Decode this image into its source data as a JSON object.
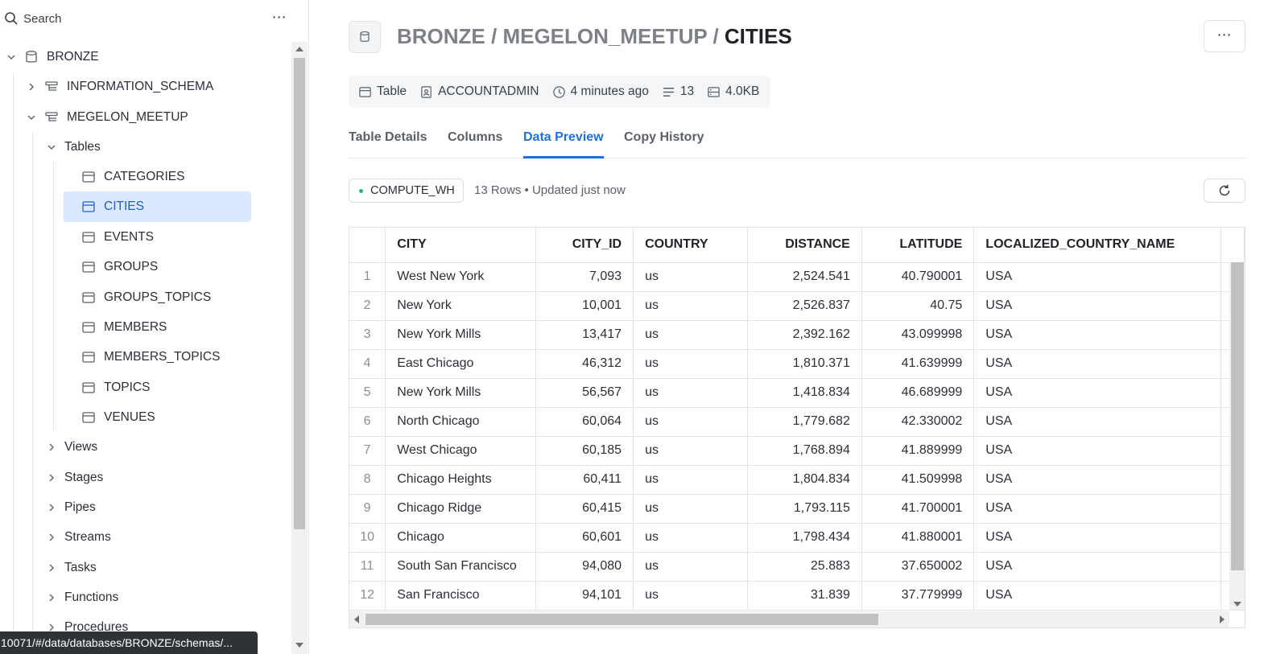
{
  "sidebar": {
    "search_label": "Search",
    "more_label": "⋯",
    "database": "BRONZE",
    "schemas": [
      "INFORMATION_SCHEMA",
      "MEGELON_MEETUP"
    ],
    "tables_label": "Tables",
    "tables": [
      "CATEGORIES",
      "CITIES",
      "EVENTS",
      "GROUPS",
      "GROUPS_TOPICS",
      "MEMBERS",
      "MEMBERS_TOPICS",
      "TOPICS",
      "VENUES"
    ],
    "selected_table": "CITIES",
    "groups": [
      "Views",
      "Stages",
      "Pipes",
      "Streams",
      "Tasks",
      "Functions",
      "Procedures"
    ]
  },
  "status_url": "10071/#/data/databases/BRONZE/schemas/...",
  "header": {
    "crumb_db": "BRONZE / ",
    "crumb_schema": "MEGELON_MEETUP / ",
    "crumb_table": "CITIES",
    "more_label": "⋯"
  },
  "meta": {
    "type": "Table",
    "owner": "ACCOUNTADMIN",
    "modified": "4 minutes ago",
    "row_count": "13",
    "size": "4.0KB"
  },
  "tabs": [
    "Table Details",
    "Columns",
    "Data Preview",
    "Copy History"
  ],
  "active_tab": "Data Preview",
  "preview": {
    "warehouse": "COMPUTE_WH",
    "rows_info": "13 Rows • Updated just now"
  },
  "table": {
    "columns": [
      "CITY",
      "CITY_ID",
      "COUNTRY",
      "DISTANCE",
      "LATITUDE",
      "LOCALIZED_COUNTRY_NAME"
    ],
    "rows": [
      [
        "1",
        "West New York",
        "7,093",
        "us",
        "2,524.541",
        "40.790001",
        "USA"
      ],
      [
        "2",
        "New York",
        "10,001",
        "us",
        "2,526.837",
        "40.75",
        "USA"
      ],
      [
        "3",
        "New York Mills",
        "13,417",
        "us",
        "2,392.162",
        "43.099998",
        "USA"
      ],
      [
        "4",
        "East Chicago",
        "46,312",
        "us",
        "1,810.371",
        "41.639999",
        "USA"
      ],
      [
        "5",
        "New York Mills",
        "56,567",
        "us",
        "1,418.834",
        "46.689999",
        "USA"
      ],
      [
        "6",
        "North Chicago",
        "60,064",
        "us",
        "1,779.682",
        "42.330002",
        "USA"
      ],
      [
        "7",
        "West Chicago",
        "60,185",
        "us",
        "1,768.894",
        "41.889999",
        "USA"
      ],
      [
        "8",
        "Chicago Heights",
        "60,411",
        "us",
        "1,804.834",
        "41.509998",
        "USA"
      ],
      [
        "9",
        "Chicago Ridge",
        "60,415",
        "us",
        "1,793.115",
        "41.700001",
        "USA"
      ],
      [
        "10",
        "Chicago",
        "60,601",
        "us",
        "1,798.434",
        "41.880001",
        "USA"
      ],
      [
        "11",
        "South San Francisco",
        "94,080",
        "us",
        "25.883",
        "37.650002",
        "USA"
      ],
      [
        "12",
        "San Francisco",
        "94,101",
        "us",
        "31.839",
        "37.779999",
        "USA"
      ]
    ]
  },
  "colors": {
    "accent": "#1f6fd6",
    "selected_bg": "#dbe8fd",
    "warehouse_dot": "#26b37a"
  }
}
